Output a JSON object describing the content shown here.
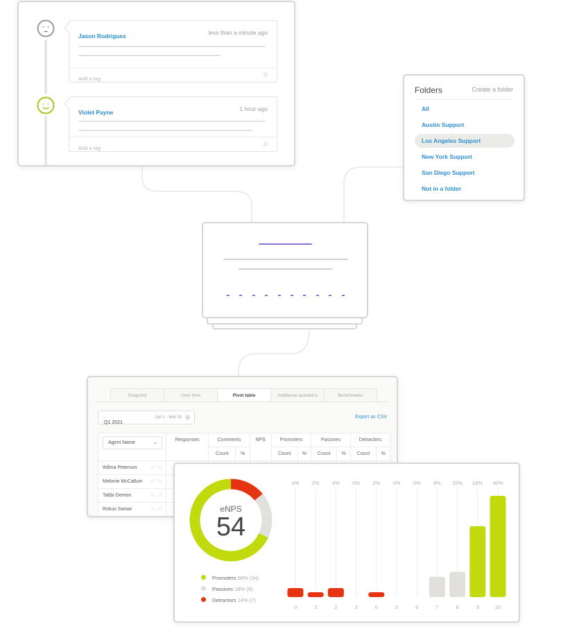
{
  "responses_card": {
    "items": [
      {
        "name": "Jason Rodriguez",
        "time": "less than a minute ago",
        "tag_placeholder": "Add a tag",
        "sentiment": "neutral",
        "face_icon": "neutral-face-icon",
        "face_color": "#999999"
      },
      {
        "name": "Violet Payne",
        "time": "1 hour ago",
        "tag_placeholder": "Add a tag",
        "sentiment": "happy",
        "face_icon": "smiley-face-icon",
        "face_color": "#a9c41a"
      }
    ],
    "gear_icon": "⚙"
  },
  "folders": {
    "title": "Folders",
    "create_label": "Create a folder",
    "items": [
      {
        "label": "All",
        "active": false
      },
      {
        "label": "Austin Support",
        "active": false
      },
      {
        "label": "Los Angeles Support",
        "active": true
      },
      {
        "label": "New York Support",
        "active": false
      },
      {
        "label": "San Diego Support",
        "active": false
      },
      {
        "label": "Not in a folder",
        "active": false
      }
    ]
  },
  "report": {
    "tabs": [
      {
        "label": "Snapshot",
        "active": false
      },
      {
        "label": "Over time",
        "active": false
      },
      {
        "label": "Pivot table",
        "active": true
      },
      {
        "label": "Additional questions",
        "active": false
      },
      {
        "label": "Benchmarks",
        "active": false
      }
    ],
    "date_filter": {
      "period": "Q1 2021",
      "range": "Jan 1 - Mar 31",
      "clear_icon": "×"
    },
    "export_label": "Export as CSV",
    "table": {
      "group_by": "Agent Name",
      "headers": [
        "Responses",
        "Comments",
        "NPS",
        "Promoters",
        "Passives",
        "Detractors"
      ],
      "subheaders": {
        "count": "Count",
        "pct": "%"
      },
      "rows": [
        "Wilma Peterson",
        "Melonie McCallum",
        "Tabbi Denton",
        "Rokus Samar"
      ],
      "row_icons": "ılı ☐"
    }
  },
  "enps": {
    "label": "eNPS",
    "value": "54",
    "colors": {
      "promoters": "#c0da0e",
      "passives": "#e1e0dc",
      "detractors": "#e63312"
    },
    "legend": [
      {
        "key": "promoters",
        "label": "Promoters",
        "detail": "68% (34)"
      },
      {
        "key": "passives",
        "label": "Passives",
        "detail": "18% (9)"
      },
      {
        "key": "detractors",
        "label": "Detractors",
        "detail": "14% (7)"
      }
    ]
  },
  "chart_data": [
    {
      "type": "pie",
      "title": "eNPS",
      "center_value": 54,
      "labels": [
        "Promoters",
        "Passives",
        "Detractors"
      ],
      "values": [
        68,
        18,
        14
      ],
      "counts": [
        34,
        9,
        7
      ],
      "colors": [
        "#c0da0e",
        "#e1e0dc",
        "#e63312"
      ]
    },
    {
      "type": "bar",
      "title": "",
      "categories": [
        "0",
        "2",
        "2",
        "3",
        "6",
        "5",
        "6",
        "7",
        "8",
        "9",
        "10"
      ],
      "values": [
        4,
        2,
        4,
        0,
        2,
        0,
        0,
        8,
        10,
        28,
        40
      ],
      "value_labels": [
        "4%",
        "2%",
        "4%",
        "0%",
        "2%",
        "0%",
        "0%",
        "8%",
        "10%",
        "28%",
        "40%"
      ],
      "groups": [
        "detractors",
        "detractors",
        "detractors",
        "detractors",
        "detractors",
        "detractors",
        "detractors",
        "passives",
        "passives",
        "promoters",
        "promoters"
      ],
      "ylim": [
        0,
        40
      ],
      "xlabel": "",
      "ylabel": ""
    }
  ]
}
